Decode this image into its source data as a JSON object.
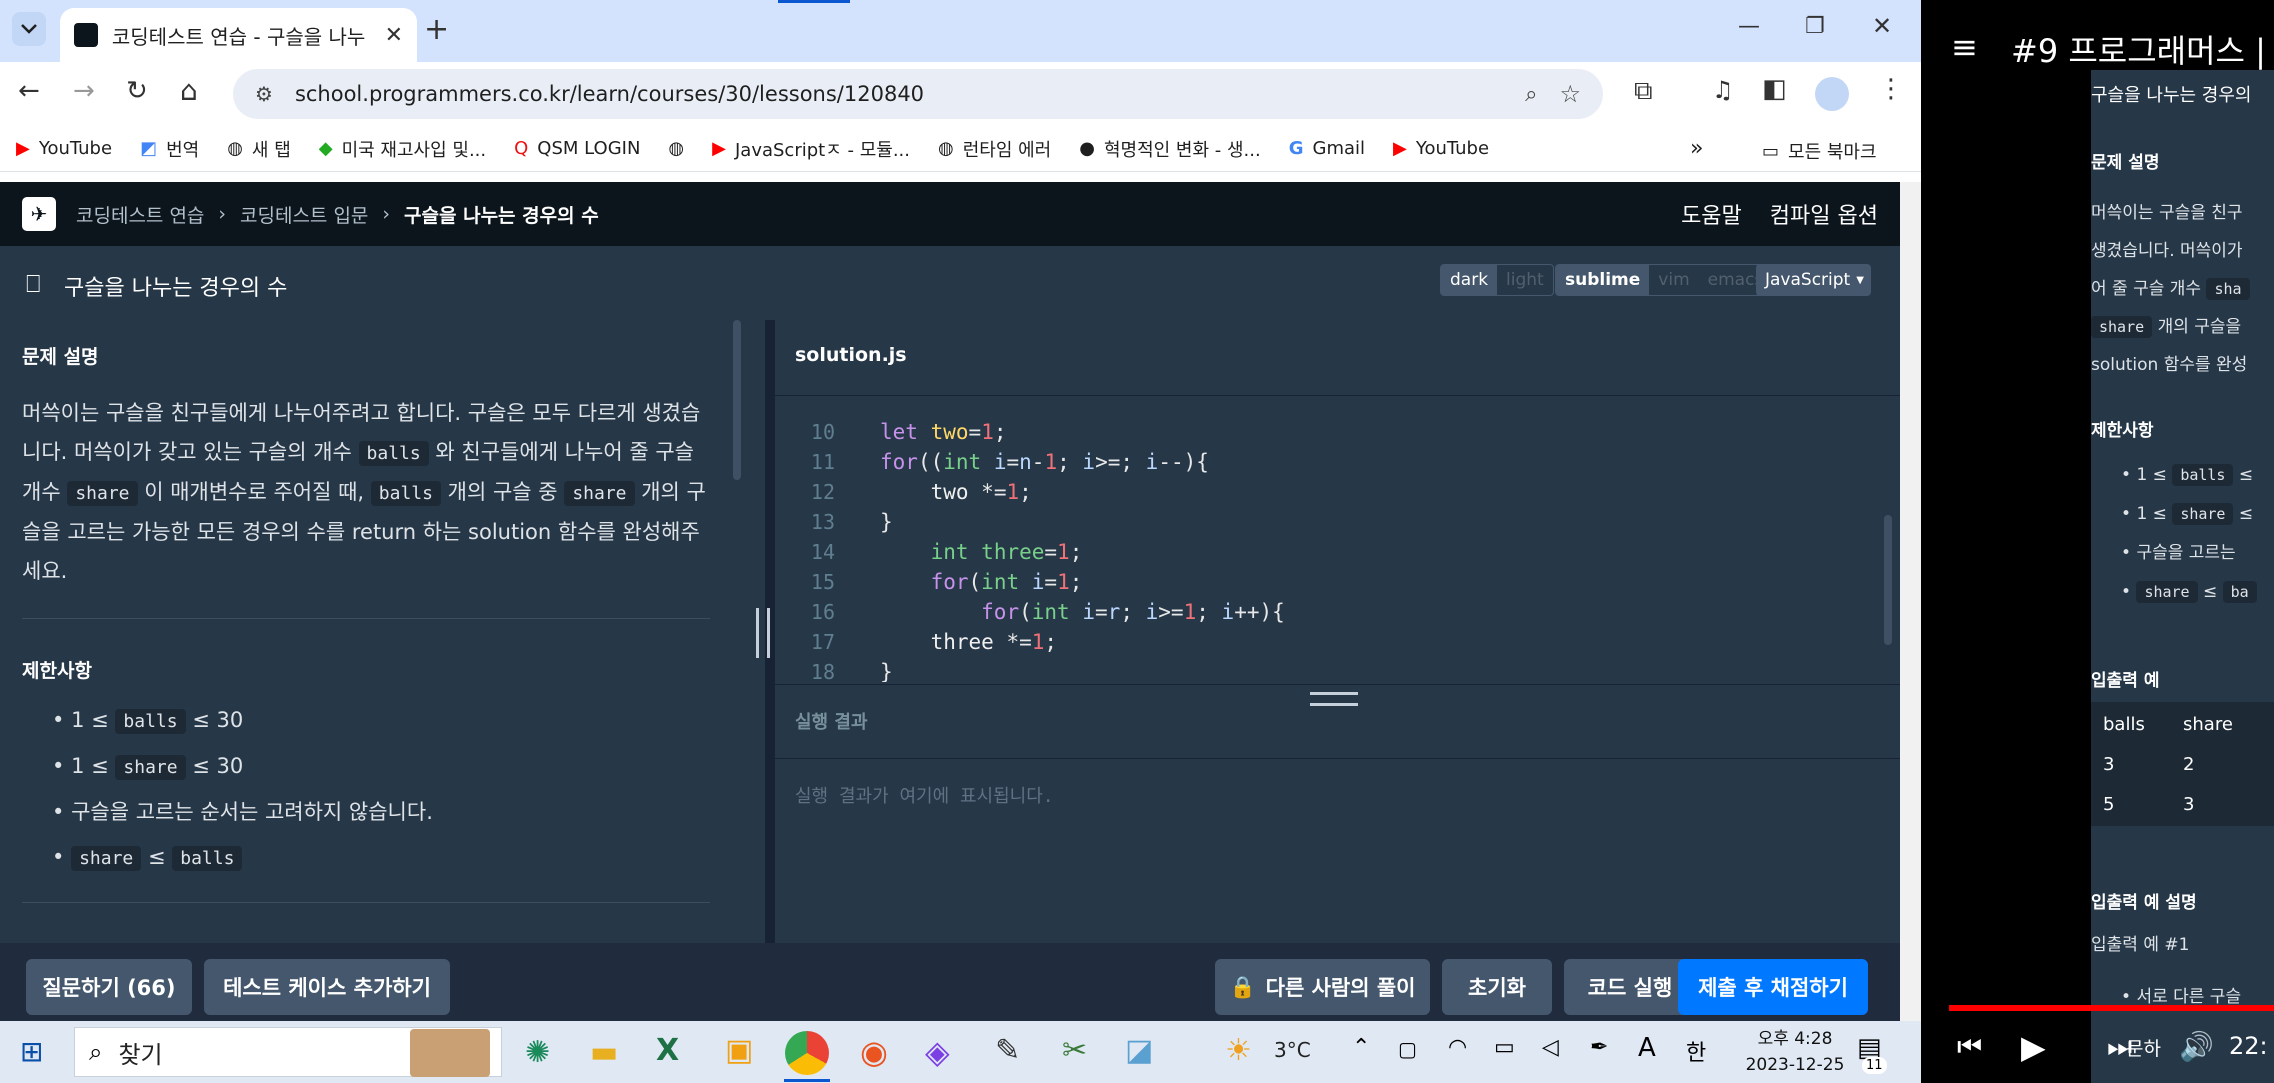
{
  "browser": {
    "tab_title": "코딩테스트 연습 - 구슬을 나누",
    "url": "school.programmers.co.kr/learn/courses/30/lessons/120840",
    "bookmarks": [
      "YouTube",
      "번역",
      "새 탭",
      "미국 재고사입 및...",
      "QSM LOGIN",
      "JavaScriptㅈ - 모듈...",
      "런타임 에러",
      "혁명적인 변화 - 생...",
      "Gmail",
      "YouTube"
    ],
    "all_bookmarks": "모든 북마크"
  },
  "app": {
    "breadcrumb": [
      "코딩테스트 연습",
      "코딩테스트 입문",
      "구슬을 나누는 경우의 수"
    ],
    "help": "도움말",
    "compile_options": "컴파일 옵션",
    "problem_title": "구슬을 나누는 경우의 수",
    "themes": [
      "dark",
      "light"
    ],
    "keymaps": [
      "sublime",
      "vim",
      "emacs"
    ],
    "language": "JavaScript",
    "desc_heading": "문제 설명",
    "desc": {
      "p1": "머쓱이는 구슬을 친구들에게 나누어주려고 합니다. 구슬은 모두 다르게 생겼습",
      "p2": "니다. 머쓱이가 갖고 있는 구슬의 개수",
      "p3": "와 친구들에게 나누어 줄 구슬",
      "p4": "개수",
      "p5": "이 매개변수로 주어질 때,",
      "p6": "개의 구슬 중",
      "p7": "개의 구",
      "p8": "슬을 고르는 가능한 모든 경우의 수를 return 하는 solution 함수를 완성해주",
      "p9": "세요."
    },
    "balls": "balls",
    "share": "share",
    "constraints_heading": "제한사항",
    "c1_pre": "1 ≤",
    "c1_post": "≤ 30",
    "c2_pre": "1 ≤",
    "c2_post": "≤ 30",
    "c3": "구슬을 고르는 순서는 고려하지 않습니다.",
    "c4_mid": "≤",
    "editor_file": "solution.js",
    "line_numbers": [
      "10",
      "11",
      "12",
      "13",
      "14",
      "15",
      "16",
      "17",
      "18"
    ],
    "result_heading": "실행 결과",
    "result_placeholder": "실행 결과가 여기에 표시됩니다.",
    "btn_question": "질문하기 (66)",
    "btn_add_test": "테스트 케이스 추가하기",
    "btn_others": "다른 사람의 풀이",
    "btn_reset": "초기화",
    "btn_run": "코드 실행",
    "btn_submit": "제출 후 채점하기"
  },
  "taskbar": {
    "search": "찾기",
    "temp": "3°C",
    "ime": "한",
    "ime_a": "A",
    "time": "오후 4:28",
    "date": "2023-12-25",
    "notif": "11"
  },
  "video": {
    "title": "#9 프로그래머스 |",
    "sub": "구슬을 나누는 경우의",
    "h1": "문제 설명",
    "d1": "머쓱이는 구슬을 친구",
    "d2": "생겼습니다. 머쓱이가",
    "d3": "어 줄 구슬 개수",
    "d3b": "sha",
    "d4": "개의 구슬을",
    "d5": "solution 함수를 완성",
    "h2": "제한사항",
    "li1": "1 ≤",
    "li1b": "≤",
    "li2": "1 ≤",
    "li2b": "≤",
    "li3": "구슬을 고르는",
    "li4": "≤",
    "li4b": "ba",
    "h3": "입출력 예",
    "th": [
      "balls",
      "share"
    ],
    "rows": [
      [
        "3",
        "2"
      ],
      [
        "5",
        "3"
      ]
    ],
    "h4": "입출력 예 설명",
    "h5": "입출력 예 #1",
    "b1": "서로 다른 구슬",
    "ctrl_time": "22:",
    "ctrl_text": "문하"
  },
  "colors": {
    "accent": "#0078ff",
    "submit": "#0078ff"
  }
}
